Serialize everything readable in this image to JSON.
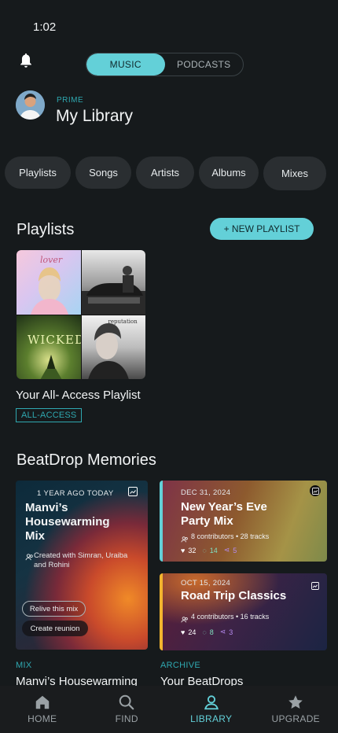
{
  "status": {
    "time": "1:02"
  },
  "header": {
    "toggle": [
      "MUSIC",
      "PODCASTS"
    ],
    "tier": "PRIME",
    "title": "My Library"
  },
  "filters": [
    "Playlists",
    "Songs",
    "Artists",
    "Albums",
    "Mixes"
  ],
  "playlists": {
    "section_title": "Playlists",
    "new_button": "+ NEW PLAYLIST",
    "item": {
      "name": "Your All- Access Playlist",
      "badge": "ALL-ACCESS"
    },
    "collage_text": {
      "t1": "lover",
      "t2": "",
      "t3": "WICKED",
      "t4": "reputation"
    }
  },
  "memories": {
    "section_title": "BeatDrop Memories",
    "big_card": {
      "eyebrow": "1 YEAR AGO TODAY",
      "title": "Manvi’s Housewarming Mix",
      "created": "Created with Simran, Uraiba and Rohini",
      "btn1": "Relive this mix",
      "btn2": "Create reunion"
    },
    "card_ny": {
      "date": "DEC 31, 2024",
      "title": "New Year’s Eve Party Mix",
      "meta": "8 contributors • 28 tracks",
      "likes": "32",
      "comments": "14",
      "shares": "5"
    },
    "card_rt": {
      "date": "OCT 15, 2024",
      "title": "Road Trip Classics",
      "meta": "4 contributors • 16 tracks",
      "likes": "24",
      "comments": "8",
      "shares": "3"
    },
    "below": [
      {
        "label": "MIX",
        "title": "Manvi’s Housewarming"
      },
      {
        "label": "ARCHIVE",
        "title": "Your BeatDrops"
      }
    ]
  },
  "nav": [
    {
      "label": "HOME",
      "icon": "home-icon"
    },
    {
      "label": "FIND",
      "icon": "search-icon"
    },
    {
      "label": "LIBRARY",
      "icon": "user-icon"
    },
    {
      "label": "UPGRADE",
      "icon": "star-icon"
    }
  ],
  "colors": {
    "accent": "#63d0d8",
    "bg": "#161a1c",
    "chip": "#2a2e31"
  }
}
